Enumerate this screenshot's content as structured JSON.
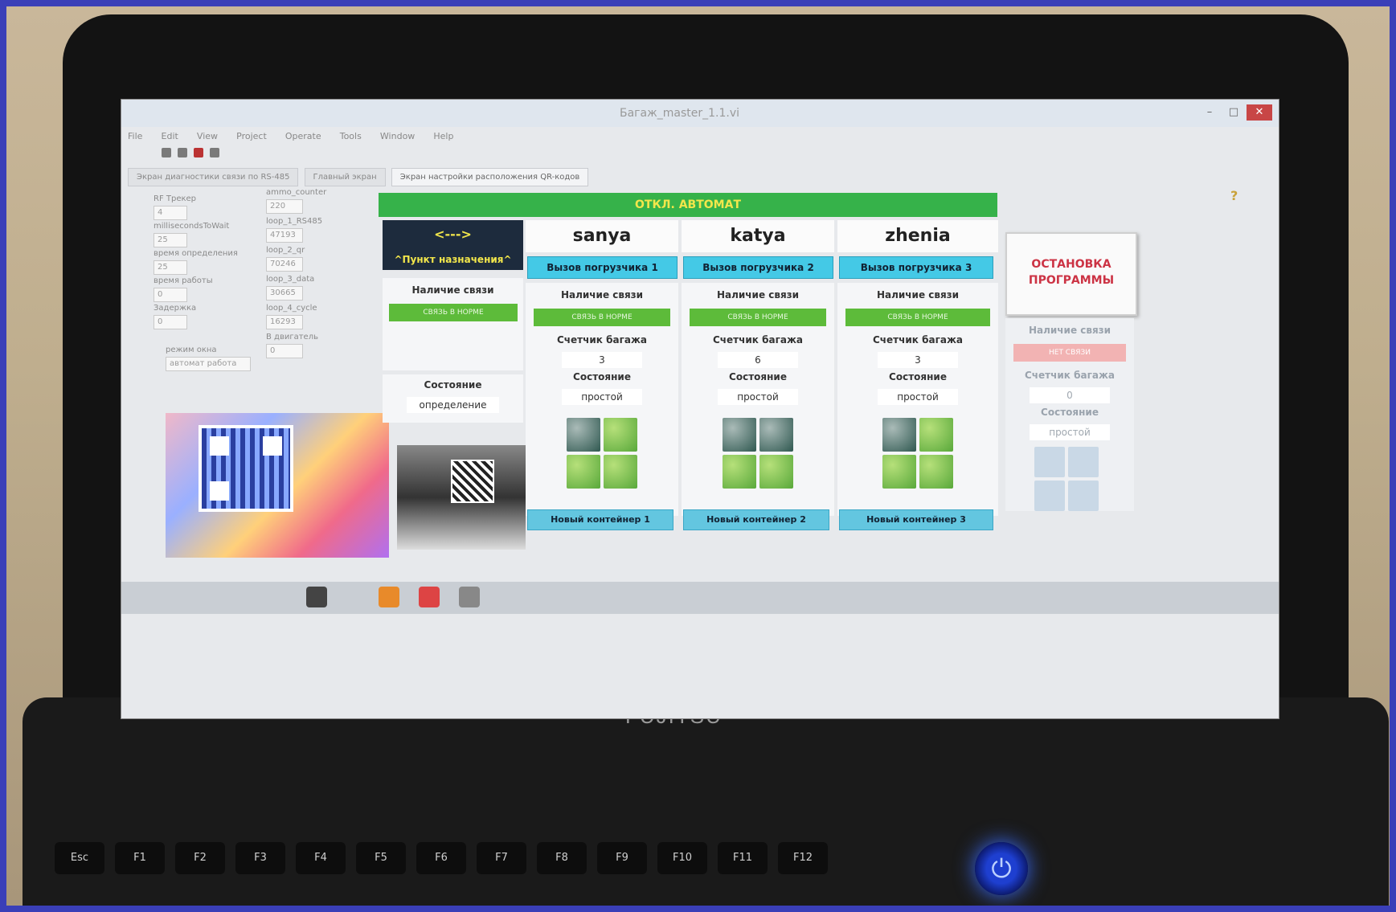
{
  "brand": "FUJITSU",
  "window": {
    "title": "Багаж_master_1.1.vi",
    "menu": [
      "File",
      "Edit",
      "View",
      "Project",
      "Operate",
      "Tools",
      "Window",
      "Help"
    ],
    "help_glyph": "?"
  },
  "tabs": [
    "Экран диагностики связи по RS-485",
    "Главный экран",
    "Экран настройки расположения QR-кодов"
  ],
  "left_panel": {
    "labels": [
      "RF Трекер",
      "millisecondsToWait",
      "время определения",
      "время работы",
      "Задержка"
    ],
    "values": [
      "4",
      "25",
      "25",
      "0",
      "0"
    ],
    "right_labels": [
      "ammo_counter",
      "loop_1_RS485",
      "loop_2_qr",
      "loop_3_data",
      "loop_4_cycle",
      "В двигатель"
    ],
    "right_values": [
      "220",
      "47193",
      "70246",
      "30665",
      "16293",
      "0"
    ],
    "mode_label": "режим окна",
    "mode_value": "автомат работа"
  },
  "header_banner": "ОТКЛ. АВТОМАТ",
  "destination": {
    "arrows": "<--->",
    "label": "^Пункт назначения^"
  },
  "stop_button": {
    "line1": "ОСТАНОВКА",
    "line2": "ПРОГРАММЫ"
  },
  "labels": {
    "link": "Наличие связи",
    "counter": "Счетчик багажа",
    "state": "Состояние",
    "ok": "СВЯЗЬ В НОРМЕ",
    "no_link": "НЕТ СВЯЗИ"
  },
  "dest_state": {
    "value": "определение"
  },
  "loaders": [
    {
      "name": "sanya",
      "call": "Вызов погрузчика 1",
      "counter": "3",
      "state": "простой",
      "new": "Новый контейнер 1"
    },
    {
      "name": "katya",
      "call": "Вызов погрузчика 2",
      "counter": "6",
      "state": "простой",
      "new": "Новый контейнер 2"
    },
    {
      "name": "zhenia",
      "call": "Вызов погрузчика 3",
      "counter": "3",
      "state": "простой",
      "new": "Новый контейнер 3"
    }
  ],
  "fourth": {
    "counter": "0",
    "state": "простой"
  },
  "keyboard": [
    "Esc",
    "F1",
    "F2",
    "F3",
    "F4",
    "F5",
    "F6",
    "F7",
    "F8",
    "F9",
    "F10",
    "F11",
    "F12"
  ],
  "colors": {
    "accent_green": "#36b24a",
    "call_cyan": "#44c9e6",
    "stop_red": "#cc3344",
    "power_blue": "#1e3fd0"
  }
}
